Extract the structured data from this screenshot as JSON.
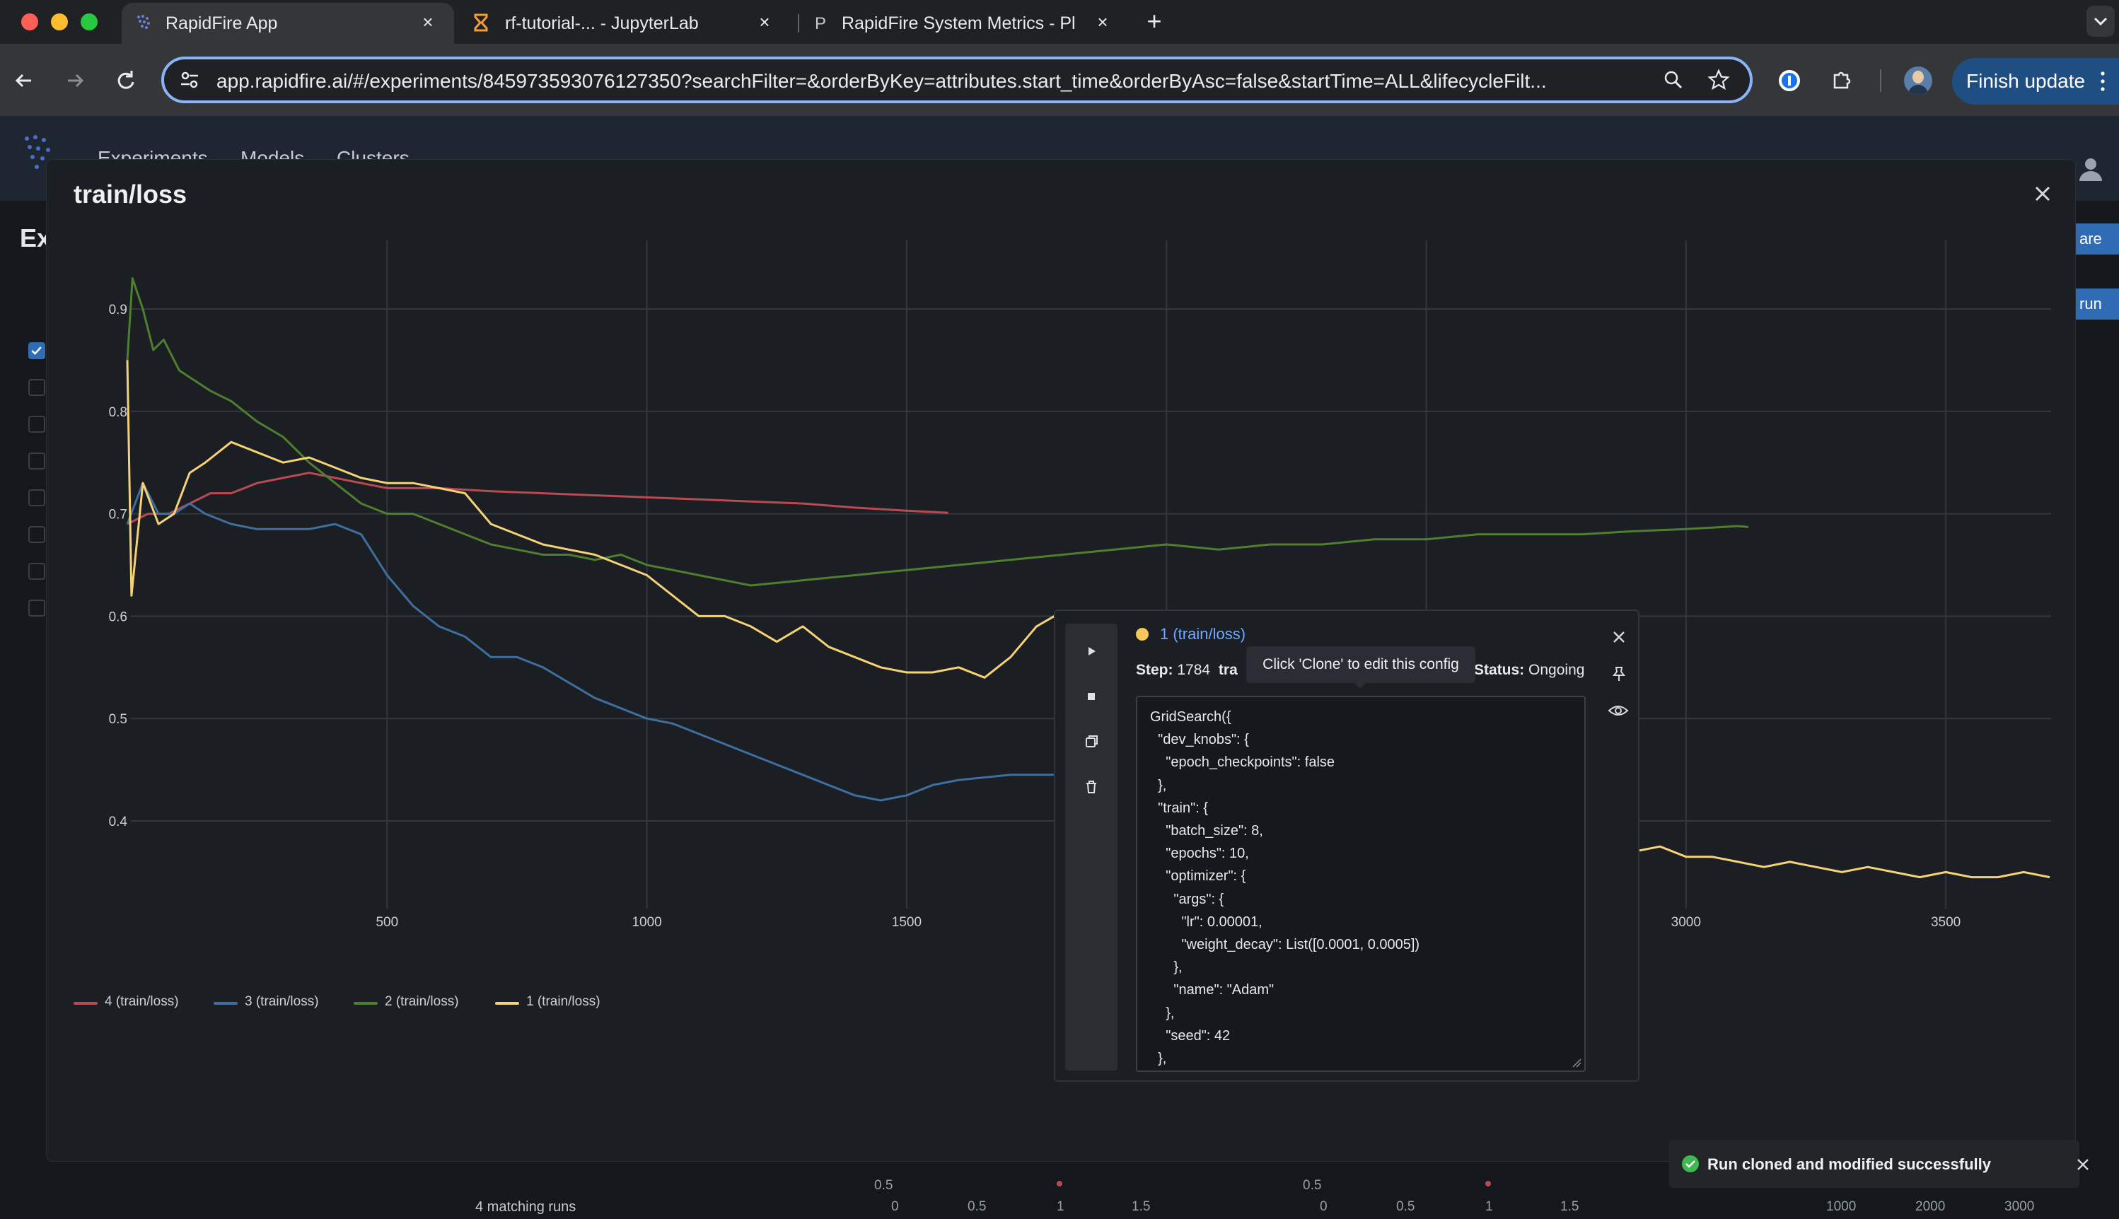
{
  "browser": {
    "tabs": [
      {
        "label": "RapidFire App"
      },
      {
        "label": "rf-tutorial-... - JupyterLab"
      },
      {
        "label": "RapidFire System Metrics - Pl"
      }
    ],
    "url": "app.rapidfire.ai/#/experiments/845973593076127350?searchFilter=&orderByKey=attributes.start_time&orderByAsc=false&startTime=ALL&lifecycleFilt...",
    "update_button": "Finish update"
  },
  "app_nav": {
    "items": [
      "Experiments",
      "Models",
      "Clusters"
    ]
  },
  "background": {
    "title_partial": "Ex",
    "buttons": [
      "are",
      "run"
    ],
    "matching_runs": "4 matching runs",
    "mini_axes": {
      "a_y": "0.5",
      "a_x": [
        "0",
        "0.5",
        "1",
        "1.5"
      ],
      "b_y": "0.5",
      "b_x": [
        "0",
        "0.5",
        "1",
        "1.5"
      ],
      "c_x": [
        "1000",
        "2000",
        "3000"
      ]
    }
  },
  "modal": {
    "title": "train/loss"
  },
  "chart_data": {
    "type": "line",
    "title": "train/loss",
    "xlabel": "",
    "ylabel": "",
    "xlim": [
      0,
      3700
    ],
    "ylim": [
      0.33,
      0.95
    ],
    "x_ticks": [
      "500",
      "1000",
      "1500",
      "2000",
      "2500",
      "3000",
      "3500"
    ],
    "y_ticks": [
      "0.4",
      "0.5",
      "0.6",
      "0.7",
      "0.8",
      "0.9"
    ],
    "grid": true,
    "legend": "bottom-left",
    "series": [
      {
        "name": "4 (train/loss)",
        "color": "#b94a52",
        "points": [
          [
            0,
            0.69
          ],
          [
            40,
            0.7
          ],
          [
            80,
            0.7
          ],
          [
            120,
            0.71
          ],
          [
            160,
            0.72
          ],
          [
            200,
            0.72
          ],
          [
            250,
            0.73
          ],
          [
            300,
            0.735
          ],
          [
            350,
            0.74
          ],
          [
            400,
            0.735
          ],
          [
            450,
            0.73
          ],
          [
            500,
            0.725
          ],
          [
            600,
            0.725
          ],
          [
            700,
            0.722
          ],
          [
            800,
            0.72
          ],
          [
            900,
            0.718
          ],
          [
            1000,
            0.716
          ],
          [
            1100,
            0.714
          ],
          [
            1200,
            0.712
          ],
          [
            1300,
            0.71
          ],
          [
            1400,
            0.706
          ],
          [
            1500,
            0.703
          ],
          [
            1580,
            0.701
          ]
        ]
      },
      {
        "name": "3 (train/loss)",
        "color": "#3e6f9e",
        "points": [
          [
            0,
            0.69
          ],
          [
            30,
            0.73
          ],
          [
            60,
            0.7
          ],
          [
            90,
            0.7
          ],
          [
            120,
            0.71
          ],
          [
            150,
            0.7
          ],
          [
            200,
            0.69
          ],
          [
            250,
            0.685
          ],
          [
            300,
            0.685
          ],
          [
            350,
            0.685
          ],
          [
            400,
            0.69
          ],
          [
            450,
            0.68
          ],
          [
            500,
            0.64
          ],
          [
            550,
            0.61
          ],
          [
            600,
            0.59
          ],
          [
            650,
            0.58
          ],
          [
            700,
            0.56
          ],
          [
            750,
            0.56
          ],
          [
            800,
            0.55
          ],
          [
            850,
            0.535
          ],
          [
            900,
            0.52
          ],
          [
            950,
            0.51
          ],
          [
            1000,
            0.5
          ],
          [
            1050,
            0.495
          ],
          [
            1100,
            0.485
          ],
          [
            1150,
            0.475
          ],
          [
            1200,
            0.465
          ],
          [
            1250,
            0.455
          ],
          [
            1300,
            0.445
          ],
          [
            1350,
            0.435
          ],
          [
            1400,
            0.425
          ],
          [
            1450,
            0.42
          ],
          [
            1500,
            0.425
          ],
          [
            1550,
            0.435
          ],
          [
            1600,
            0.44
          ],
          [
            1700,
            0.445
          ],
          [
            1800,
            0.445
          ],
          [
            1860,
            0.44
          ]
        ]
      },
      {
        "name": "2 (train/loss)",
        "color": "#4e7f2e",
        "points": [
          [
            0,
            0.85
          ],
          [
            10,
            0.93
          ],
          [
            30,
            0.9
          ],
          [
            50,
            0.86
          ],
          [
            70,
            0.87
          ],
          [
            100,
            0.84
          ],
          [
            130,
            0.83
          ],
          [
            160,
            0.82
          ],
          [
            200,
            0.81
          ],
          [
            250,
            0.79
          ],
          [
            300,
            0.775
          ],
          [
            350,
            0.75
          ],
          [
            400,
            0.73
          ],
          [
            450,
            0.71
          ],
          [
            500,
            0.7
          ],
          [
            550,
            0.7
          ],
          [
            600,
            0.69
          ],
          [
            650,
            0.68
          ],
          [
            700,
            0.67
          ],
          [
            750,
            0.665
          ],
          [
            800,
            0.66
          ],
          [
            850,
            0.66
          ],
          [
            900,
            0.655
          ],
          [
            950,
            0.66
          ],
          [
            1000,
            0.65
          ],
          [
            1050,
            0.645
          ],
          [
            1100,
            0.64
          ],
          [
            1150,
            0.635
          ],
          [
            1200,
            0.63
          ],
          [
            1300,
            0.635
          ],
          [
            1400,
            0.64
          ],
          [
            1500,
            0.645
          ],
          [
            1600,
            0.65
          ],
          [
            1700,
            0.655
          ],
          [
            1800,
            0.66
          ],
          [
            1900,
            0.665
          ],
          [
            2000,
            0.67
          ],
          [
            2100,
            0.665
          ],
          [
            2200,
            0.67
          ],
          [
            2300,
            0.67
          ],
          [
            2400,
            0.675
          ],
          [
            2500,
            0.675
          ],
          [
            2600,
            0.68
          ],
          [
            2700,
            0.68
          ],
          [
            2800,
            0.68
          ],
          [
            2900,
            0.683
          ],
          [
            3000,
            0.685
          ],
          [
            3100,
            0.688
          ],
          [
            3120,
            0.687
          ]
        ]
      },
      {
        "name": "1 (train/loss)",
        "color": "#f6d277",
        "points": [
          [
            0,
            0.85
          ],
          [
            8,
            0.62
          ],
          [
            30,
            0.73
          ],
          [
            60,
            0.69
          ],
          [
            90,
            0.7
          ],
          [
            120,
            0.74
          ],
          [
            150,
            0.75
          ],
          [
            200,
            0.77
          ],
          [
            250,
            0.76
          ],
          [
            300,
            0.75
          ],
          [
            350,
            0.755
          ],
          [
            400,
            0.745
          ],
          [
            450,
            0.735
          ],
          [
            500,
            0.73
          ],
          [
            550,
            0.73
          ],
          [
            600,
            0.725
          ],
          [
            650,
            0.72
          ],
          [
            700,
            0.69
          ],
          [
            750,
            0.68
          ],
          [
            800,
            0.67
          ],
          [
            850,
            0.665
          ],
          [
            900,
            0.66
          ],
          [
            950,
            0.65
          ],
          [
            1000,
            0.64
          ],
          [
            1050,
            0.62
          ],
          [
            1100,
            0.6
          ],
          [
            1150,
            0.6
          ],
          [
            1200,
            0.59
          ],
          [
            1250,
            0.575
          ],
          [
            1300,
            0.59
          ],
          [
            1350,
            0.57
          ],
          [
            1400,
            0.56
          ],
          [
            1450,
            0.55
          ],
          [
            1500,
            0.545
          ],
          [
            1550,
            0.545
          ],
          [
            1600,
            0.55
          ],
          [
            1650,
            0.54
          ],
          [
            1700,
            0.56
          ],
          [
            1750,
            0.59
          ],
          [
            1784,
            0.6
          ],
          [
            2440,
            0.38
          ],
          [
            2470,
            0.395
          ],
          [
            2500,
            0.39
          ],
          [
            2550,
            0.385
          ],
          [
            2600,
            0.38
          ],
          [
            2650,
            0.39
          ],
          [
            2700,
            0.385
          ],
          [
            2750,
            0.38
          ],
          [
            2800,
            0.375
          ],
          [
            2850,
            0.365
          ],
          [
            2900,
            0.37
          ],
          [
            2950,
            0.375
          ],
          [
            3000,
            0.365
          ],
          [
            3050,
            0.365
          ],
          [
            3100,
            0.36
          ],
          [
            3150,
            0.355
          ],
          [
            3200,
            0.36
          ],
          [
            3250,
            0.355
          ],
          [
            3300,
            0.35
          ],
          [
            3350,
            0.355
          ],
          [
            3400,
            0.35
          ],
          [
            3450,
            0.345
          ],
          [
            3500,
            0.35
          ],
          [
            3550,
            0.345
          ],
          [
            3600,
            0.345
          ],
          [
            3650,
            0.35
          ],
          [
            3700,
            0.345
          ]
        ]
      }
    ]
  },
  "popover": {
    "run_name": "1 (train/loss)",
    "step_label": "Step:",
    "step_value": "1784",
    "metric_partial": "tra",
    "status_label": "Status:",
    "status_value": "Ongoing",
    "tooltip": "Click 'Clone' to edit this config",
    "config_text": "GridSearch({\n  \"dev_knobs\": {\n    \"epoch_checkpoints\": false\n  },\n  \"train\": {\n    \"batch_size\": 8,\n    \"epochs\": 10,\n    \"optimizer\": {\n      \"args\": {\n        \"lr\": 0.00001,\n        \"weight_decay\": List([0.0001, 0.0005])\n      },\n      \"name\": \"Adam\"\n    },\n    \"seed\": 42\n  },"
  },
  "toast": {
    "message": "Run cloned and modified successfully"
  }
}
